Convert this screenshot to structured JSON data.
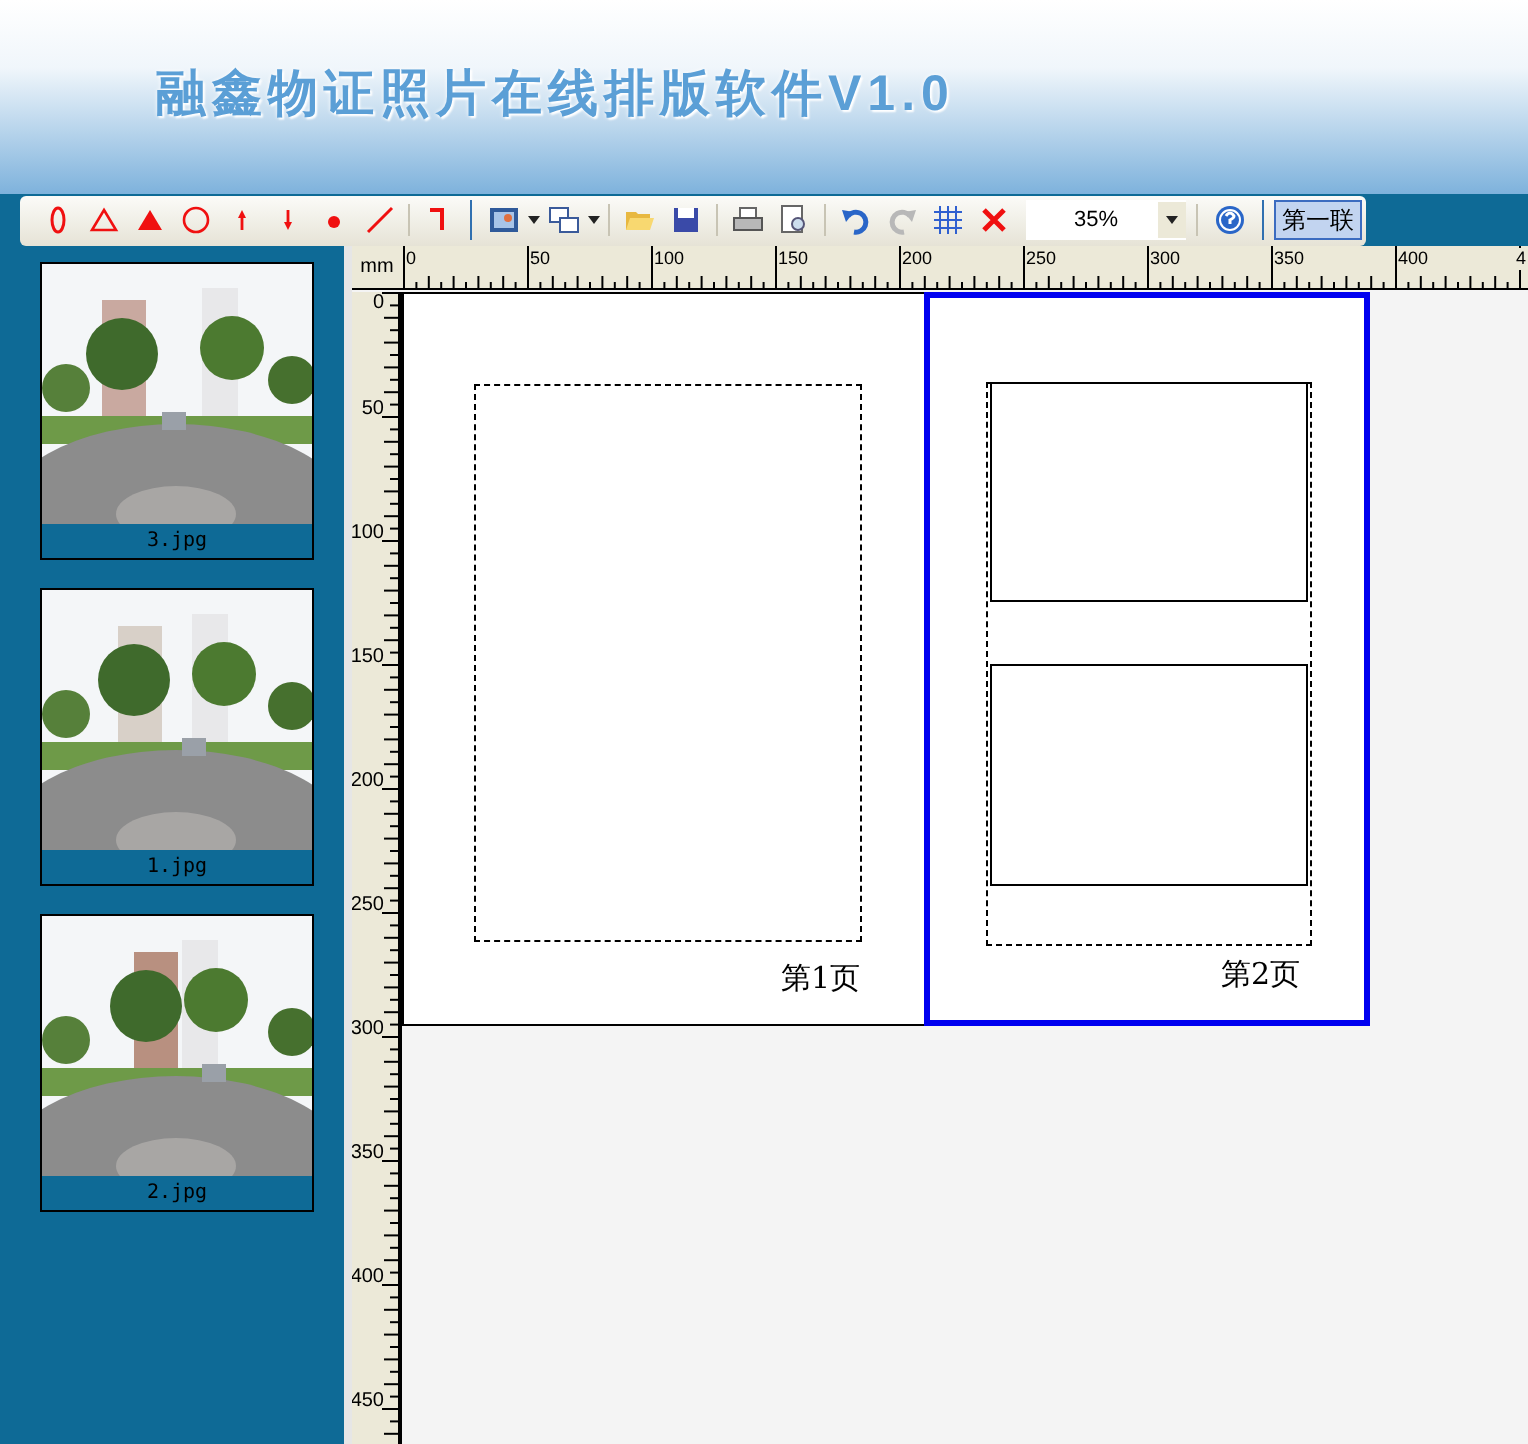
{
  "window": {
    "title": "融鑫物证照片在线排版软件V1.0"
  },
  "toolbar": {
    "zoom": "35%",
    "sheet_button": {
      "label": "第一联",
      "selected": true
    }
  },
  "thumbnails": [
    {
      "kind": "picture",
      "caption": "3.jpg"
    },
    {
      "kind": "picture",
      "caption": "1.jpg"
    },
    {
      "kind": "picture",
      "caption": "2.jpg"
    }
  ],
  "ruler": {
    "unit": "mm",
    "top_labels": [
      "0",
      "50",
      "100",
      "150",
      "200",
      "250",
      "300",
      "350",
      "400",
      "4"
    ],
    "side_labels": [
      "0",
      "50",
      "100",
      "150",
      "200",
      "250",
      "300",
      "350",
      "400",
      "450"
    ]
  },
  "pages": [
    {
      "label": "第1页",
      "kind": "single",
      "selected": false
    },
    {
      "label": "第2页",
      "kind": "double",
      "selected": true
    }
  ]
}
